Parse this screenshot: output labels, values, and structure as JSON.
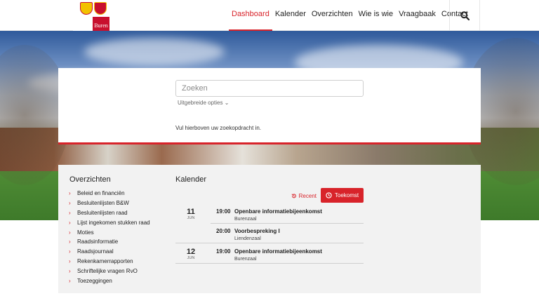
{
  "header": {
    "logo_text": "Buren",
    "nav": [
      {
        "label": "Dashboard",
        "active": true
      },
      {
        "label": "Kalender",
        "active": false
      },
      {
        "label": "Overzichten",
        "active": false
      },
      {
        "label": "Wie is wie",
        "active": false
      },
      {
        "label": "Vraagbaak",
        "active": false
      },
      {
        "label": "Contact",
        "active": false
      }
    ],
    "search_icon": "search-icon"
  },
  "search": {
    "placeholder": "Zoeken",
    "advanced_label": "Uitgebreide opties",
    "hint": "Vul hierboven uw zoekopdracht in."
  },
  "overzichten": {
    "title": "Overzichten",
    "items": [
      "Beleid en financiën",
      "Besluitenlijsten B&W",
      "Besluitenlijsten raad",
      "Lijst ingekomen stukken raad",
      "Moties",
      "Raadsinformatie",
      "Raadsjournaal",
      "Rekenkamerrapporten",
      "Schriftelijke vragen RvO",
      "Toezeggingen"
    ]
  },
  "kalender": {
    "title": "Kalender",
    "recent_label": "Recent",
    "future_label": "Toekomst",
    "events": [
      {
        "day": "11",
        "month": "JUN",
        "time": "19:00",
        "title": "Openbare informatiebijeenkomst",
        "location": "Burenzaal"
      },
      {
        "day": "",
        "month": "",
        "time": "20:00",
        "title": "Voorbespreking I",
        "location": "Liendenzaal"
      },
      {
        "day": "12",
        "month": "JUN",
        "time": "19:00",
        "title": "Openbare informatiebijeenkomst",
        "location": "Burenzaal"
      }
    ]
  },
  "colors": {
    "accent": "#d8232a",
    "panel": "#f2f2f2"
  }
}
